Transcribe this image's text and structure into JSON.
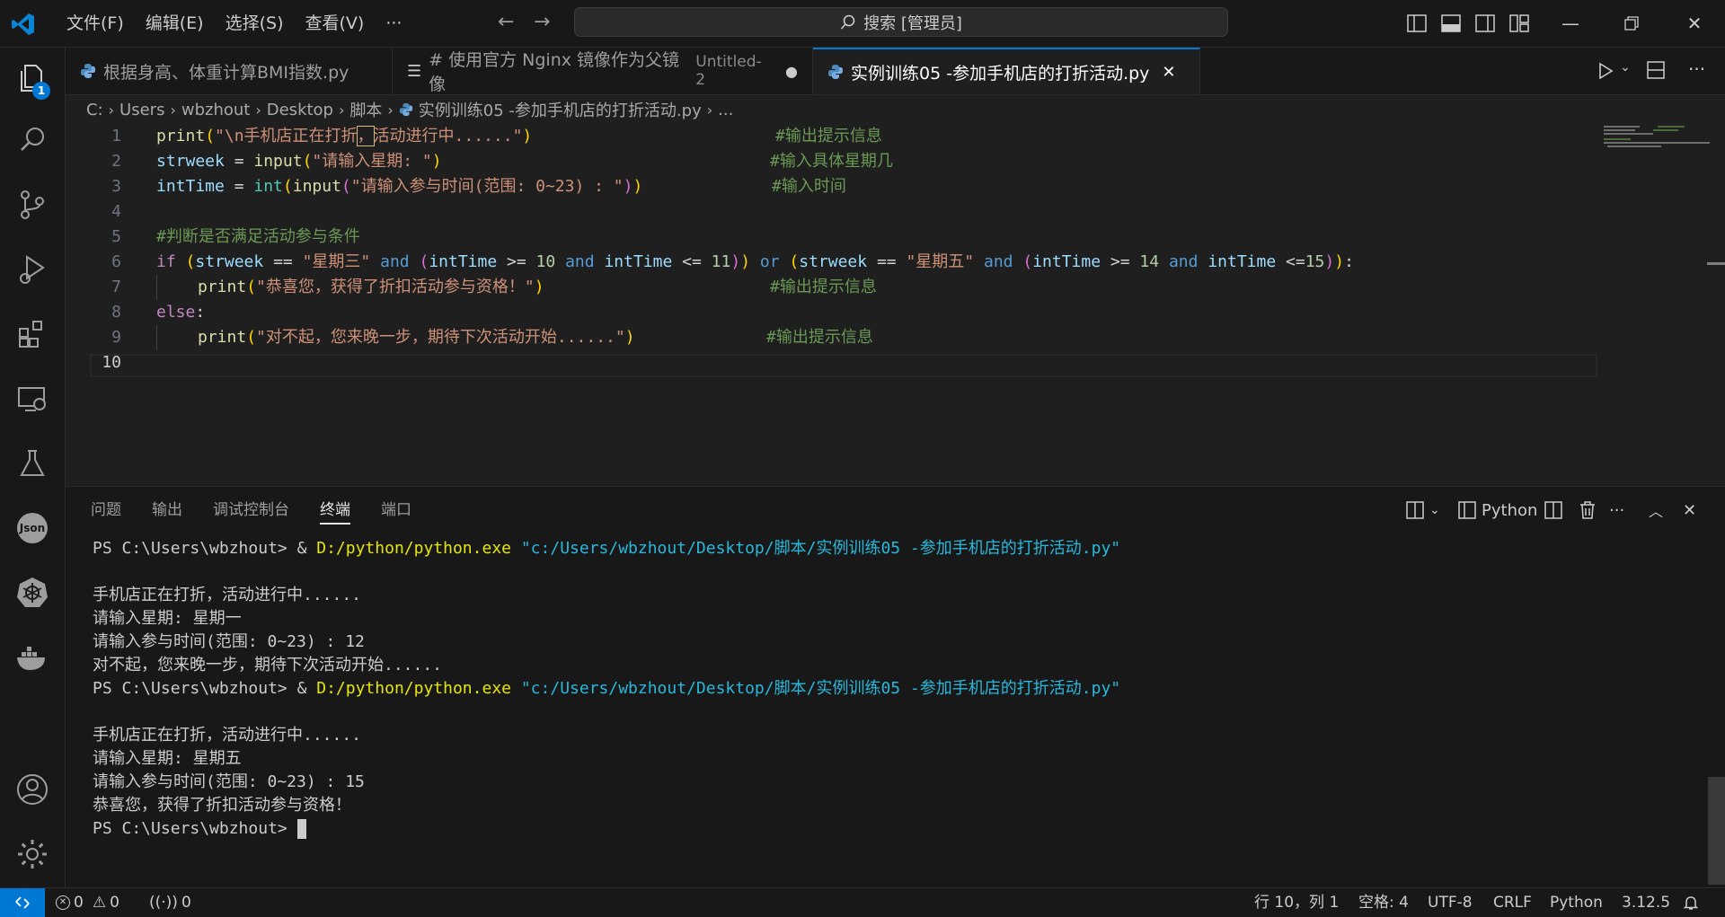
{
  "menu": [
    "文件(F)",
    "编辑(E)",
    "选择(S)",
    "查看(V)",
    "···"
  ],
  "search": {
    "label": "搜索 [管理员]"
  },
  "activity": {
    "explorer_badge": "1",
    "json_label": "Json"
  },
  "tabs": [
    {
      "label": "根据身高、体重计算BMI指数.py"
    },
    {
      "label": "# 使用官方 Nginx 镜像作为父镜像",
      "sub": "Untitled-2"
    },
    {
      "label": "实例训练05 -参加手机店的打折活动.py"
    }
  ],
  "breadcrumb": [
    "C:",
    "Users",
    "wbzhout",
    "Desktop",
    "脚本",
    "实例训练05 -参加手机店的打折活动.py",
    "..."
  ],
  "editor": {
    "line_numbers": [
      "1",
      "2",
      "3",
      "4",
      "5",
      "6",
      "7",
      "8",
      "9",
      "10"
    ],
    "line1": {
      "fn": "print",
      "s1": "\"\\n手机店正在打折",
      "s2": "，",
      "s3": "活动进行中......\"",
      "comment": "#输出提示信息"
    },
    "line2": {
      "var": "strweek",
      "op": " = ",
      "fn": "input",
      "s": "\"请输入星期: \"",
      "comment": "#输入具体星期几"
    },
    "line3": {
      "var": "intTime",
      "op": " = ",
      "fn1": "int",
      "fn2": "input",
      "s": "\"请输入参与时间(范围: 0~23) : \"",
      "comment": "#输入时间"
    },
    "line5": {
      "comment": "#判断是否满足活动参与条件"
    },
    "line6": {
      "kw_if": "if",
      "v1": "strweek",
      "eq": " == ",
      "s1": "\"星期三\"",
      "and": "and",
      "v2": "intTime",
      "ge": " >= ",
      "n1": "10",
      "le": " <= ",
      "n2": "11",
      "or": "or",
      "s2": "\"星期五\"",
      "n3": "14",
      "le2": " <=",
      "n4": "15",
      "colon": ":"
    },
    "line7": {
      "fn": "print",
      "s": "\"恭喜您，获得了折扣活动参与资格！\"",
      "comment": "#输出提示信息"
    },
    "line8": {
      "kw": "else",
      "colon": ":"
    },
    "line9": {
      "fn": "print",
      "s": "\"对不起，您来晚一步，期待下次活动开始......\"",
      "comment": "#输出提示信息"
    }
  },
  "panel": {
    "tabs": [
      "问题",
      "输出",
      "调试控制台",
      "终端",
      "端口"
    ],
    "active_tab": "终端",
    "shell_label": "Python"
  },
  "terminal": {
    "prompt_cmd": "PS C:\\Users\\wbzhout> & ",
    "exe": "D:/python/python.exe",
    "script": "\"c:/Users/wbzhout/Desktop/脚本/实例训练05 -参加手机店的打折活动.py\"",
    "run1": [
      "手机店正在打折，活动进行中......",
      "请输入星期: 星期一",
      "请输入参与时间(范围: 0~23) : 12",
      "对不起，您来晚一步，期待下次活动开始......"
    ],
    "run2": [
      "手机店正在打折，活动进行中......",
      "请输入星期: 星期五",
      "请输入参与时间(范围: 0~23) : 15",
      "恭喜您，获得了折扣活动参与资格！"
    ],
    "final_prompt": "PS C:\\Users\\wbzhout> "
  },
  "status": {
    "errors": "0",
    "warnings": "0",
    "ports": "0",
    "position": "行 10，列 1",
    "spaces": "空格: 4",
    "encoding": "UTF-8",
    "eol": "CRLF",
    "language": "Python",
    "version": "3.12.5"
  }
}
